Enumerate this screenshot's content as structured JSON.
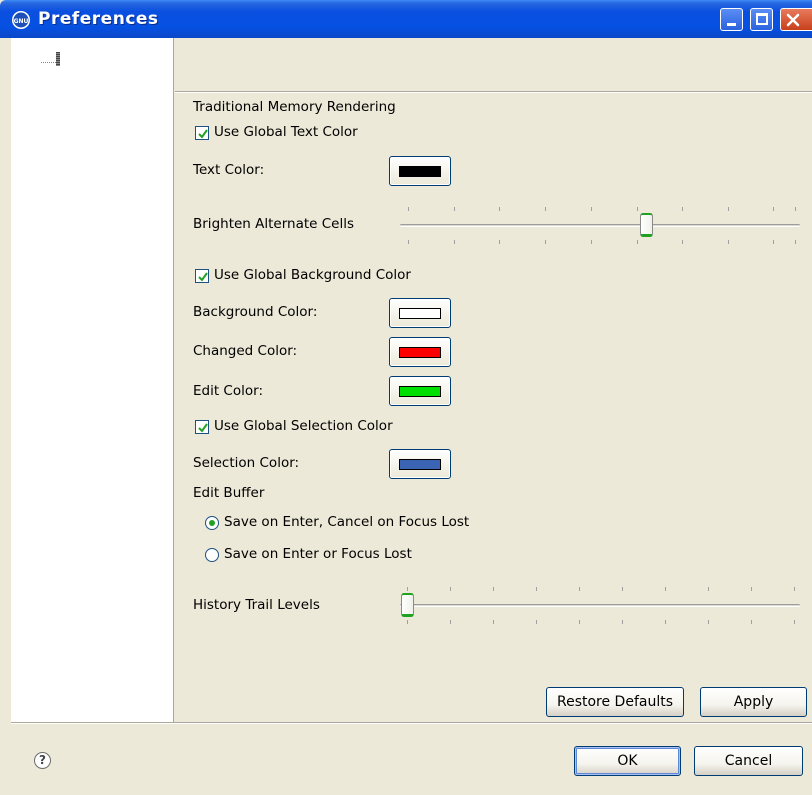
{
  "window": {
    "title": "Preferences",
    "app_icon_label": "GNU"
  },
  "section": {
    "title": "Traditional Memory Rendering",
    "use_global_text_color": {
      "label": "Use Global Text Color",
      "checked": true
    },
    "text_color": {
      "label": "Text Color:",
      "value": "#000000"
    },
    "brighten_alternate_cells": {
      "label": "Brighten Alternate Cells",
      "value": 0.6
    },
    "use_global_background_color": {
      "label": "Use Global Background Color",
      "checked": true
    },
    "background_color": {
      "label": "Background Color:",
      "value": "#ffffff"
    },
    "changed_color": {
      "label": "Changed Color:",
      "value": "#ff0000"
    },
    "edit_color": {
      "label": "Edit Color:",
      "value": "#00e000"
    },
    "use_global_selection_color": {
      "label": "Use Global Selection Color",
      "checked": true
    },
    "selection_color": {
      "label": "Selection Color:",
      "value": "#3c64b4"
    },
    "edit_buffer": {
      "label": "Edit Buffer",
      "options": [
        {
          "label": "Save on Enter, Cancel on Focus Lost",
          "selected": true
        },
        {
          "label": "Save on Enter or Focus Lost",
          "selected": false
        }
      ]
    },
    "history_trail_levels": {
      "label": "History Trail Levels",
      "value": 0
    }
  },
  "buttons": {
    "restore_defaults": "Restore Defaults",
    "apply": "Apply",
    "ok": "OK",
    "cancel": "Cancel",
    "help": "?"
  },
  "colors": {
    "titlebar": "#0651e2",
    "accent_green": "#21a121",
    "dialog_bg": "#ece9d8"
  }
}
